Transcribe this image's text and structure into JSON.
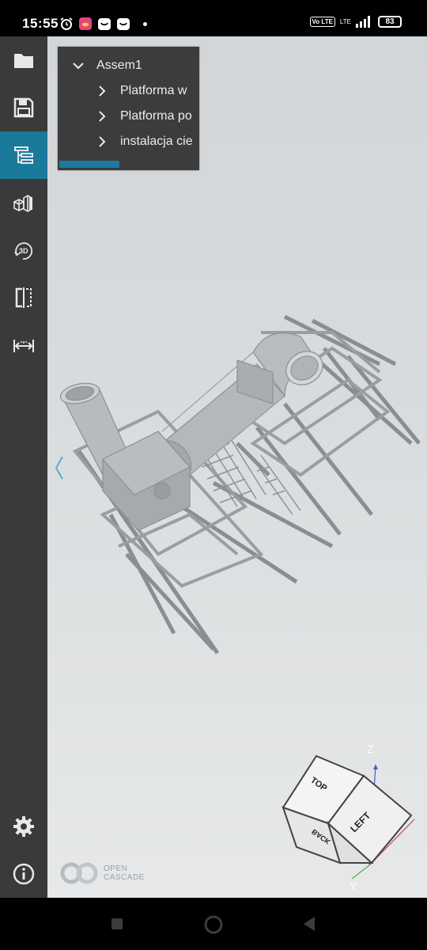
{
  "status_bar": {
    "time": "15:55",
    "volte": "Vo LTE",
    "network": "LTE",
    "battery": "83"
  },
  "sidebar": {
    "items": [
      {
        "name": "open-file",
        "icon": "folder-icon"
      },
      {
        "name": "save",
        "icon": "floppy-icon"
      },
      {
        "name": "model-tree",
        "icon": "tree-icon",
        "active": true
      },
      {
        "name": "display-mode",
        "icon": "cubes-icon"
      },
      {
        "name": "3d-view",
        "icon": "rotate-3d-icon",
        "label": "3D"
      },
      {
        "name": "clipping",
        "icon": "clip-plane-icon"
      },
      {
        "name": "measure",
        "icon": "measure-icon"
      },
      {
        "name": "settings",
        "icon": "gear-icon"
      },
      {
        "name": "about",
        "icon": "info-icon"
      }
    ]
  },
  "model_tree": {
    "root": "Assem1",
    "children": [
      "Platforma w",
      "Platforma po",
      "instalacja cie"
    ]
  },
  "viewcube": {
    "faces": {
      "top": "TOP",
      "left": "LEFT",
      "back": "BACK"
    },
    "axes": {
      "z": "Z",
      "y": "Y"
    }
  },
  "logo": {
    "line1": "OPEN",
    "line2": "CASCADE"
  },
  "colors": {
    "accent": "#197a9a",
    "sidebar": "#3a3a3a",
    "tree_bg": "#3c3c3c"
  }
}
